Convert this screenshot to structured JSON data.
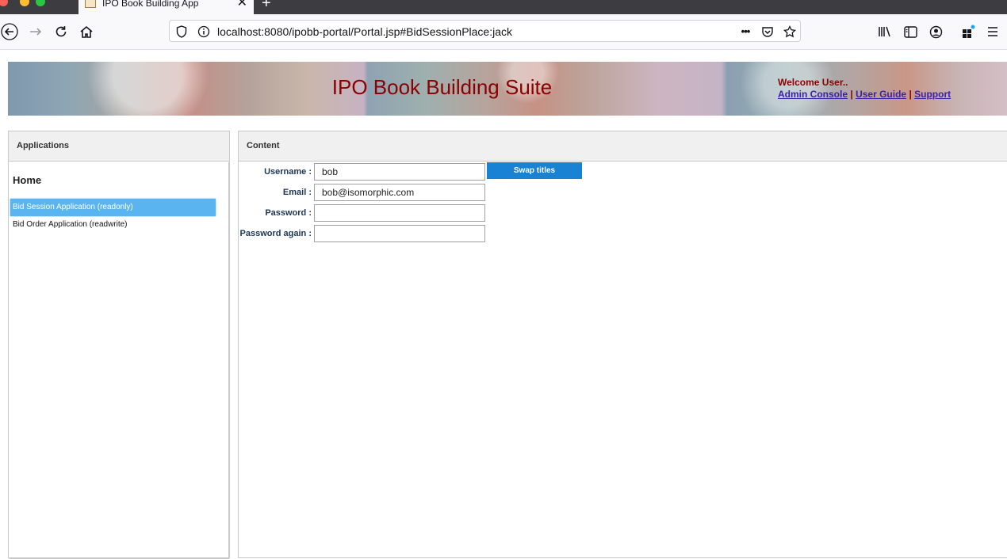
{
  "browser": {
    "tab_title": "IPO Book Building App",
    "tab_close": "✕",
    "new_tab": "+",
    "url": "localhost:8080/ipobb-portal/Portal.jsp#BidSessionPlace:jack",
    "url_more": "•••"
  },
  "banner": {
    "title": "IPO Book Building Suite",
    "welcome": "Welcome User..",
    "links": [
      "Admin Console",
      "User Guide",
      "Support"
    ],
    "separator": "|"
  },
  "applications": {
    "header": "Applications",
    "home": "Home",
    "items": [
      {
        "label": "Bid Session Application (readonly)",
        "selected": true
      },
      {
        "label": "Bid Order Application (readwrite)",
        "selected": false
      }
    ]
  },
  "content": {
    "header": "Content",
    "fields": [
      {
        "label": "Username :",
        "value": "bob"
      },
      {
        "label": "Email :",
        "value": "bob@isomorphic.com"
      },
      {
        "label": "Password :",
        "value": ""
      },
      {
        "label": "Password again :",
        "value": ""
      }
    ],
    "swap_button": "Swap titles"
  },
  "colors": {
    "accent": "#1a82d2",
    "selection": "#5ab4f0",
    "banner_text": "#8b0000"
  }
}
